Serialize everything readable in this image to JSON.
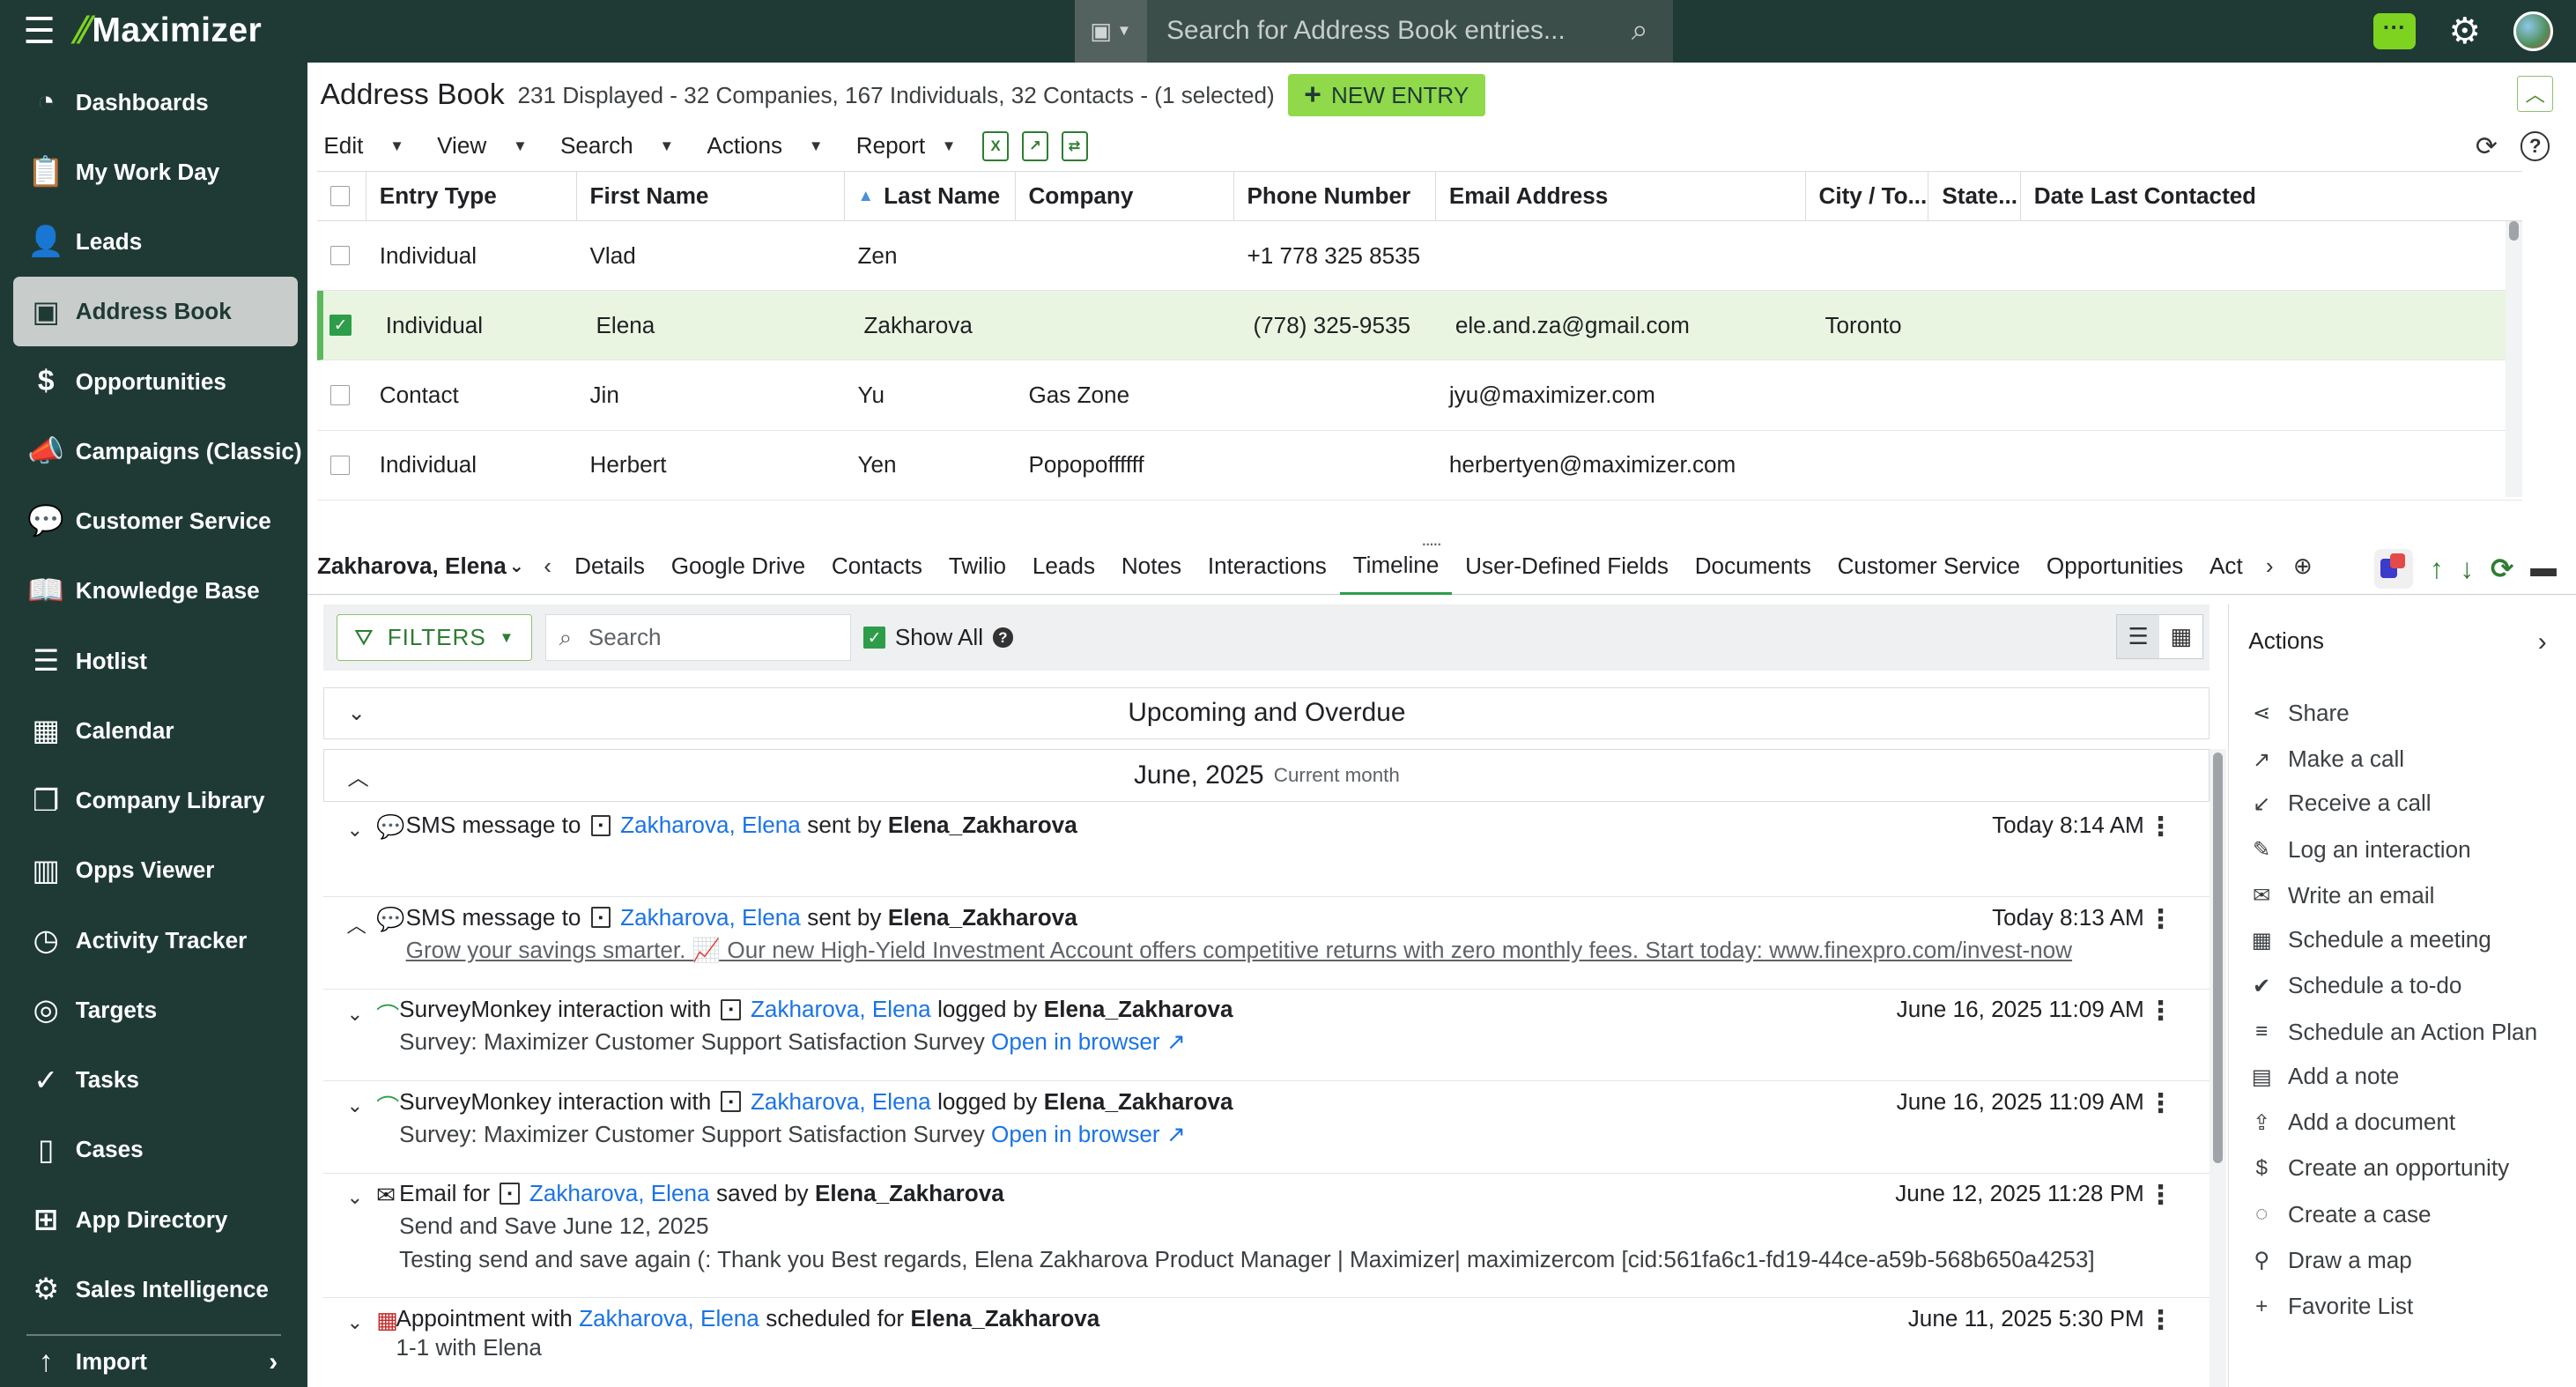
{
  "app": {
    "logo_text": "Maximizer",
    "search_placeholder": "Search for Address Book entries..."
  },
  "sidebar": {
    "items": [
      {
        "label": "Dashboards",
        "icon": "dashboard-icon"
      },
      {
        "label": "My Work Day",
        "icon": "clipboard-icon"
      },
      {
        "label": "Leads",
        "icon": "leads-icon"
      },
      {
        "label": "Address Book",
        "icon": "address-book-icon",
        "active": true
      },
      {
        "label": "Opportunities",
        "icon": "dollar-icon"
      },
      {
        "label": "Campaigns (Classic)",
        "icon": "megaphone-icon"
      },
      {
        "label": "Customer Service",
        "icon": "chat-bubble-icon"
      },
      {
        "label": "Knowledge Base",
        "icon": "book-icon"
      },
      {
        "label": "Hotlist",
        "icon": "list-icon"
      },
      {
        "label": "Calendar",
        "icon": "calendar-icon"
      },
      {
        "label": "Company Library",
        "icon": "documents-icon"
      },
      {
        "label": "Opps Viewer",
        "icon": "columns-icon"
      },
      {
        "label": "Activity Tracker",
        "icon": "calendar-clock-icon"
      },
      {
        "label": "Targets",
        "icon": "target-icon"
      },
      {
        "label": "Tasks",
        "icon": "check-circle-icon"
      },
      {
        "label": "Cases",
        "icon": "cases-icon"
      },
      {
        "label": "App Directory",
        "icon": "app-directory-icon"
      },
      {
        "label": "Sales Intelligence",
        "icon": "sales-intel-icon"
      }
    ],
    "import_label": "Import"
  },
  "address_book": {
    "title": "Address Book",
    "count_text": "231 Displayed - 32 Companies, 167 Individuals, 32 Contacts - (1 selected)",
    "new_entry_label": "NEW ENTRY",
    "menu": [
      "Edit",
      "View",
      "Search",
      "Actions",
      "Report"
    ],
    "columns": [
      "Entry Type",
      "First Name",
      "Last Name",
      "Company",
      "Phone Number",
      "Email Address",
      "City / To...",
      "State...",
      "Date Last Contacted"
    ],
    "rows": [
      {
        "type": "Individual",
        "first": "Vlad",
        "last": "Zen",
        "company": "",
        "phone": "+1 778 325 8535",
        "email": "",
        "city": "",
        "selected": false
      },
      {
        "type": "Individual",
        "first": "Elena",
        "last": "Zakharova",
        "company": "",
        "phone": "(778) 325-9535",
        "email": "ele.and.za@gmail.com",
        "city": "Toronto",
        "selected": true
      },
      {
        "type": "Contact",
        "first": "Jin",
        "last": "Yu",
        "company": "Gas Zone",
        "phone": "",
        "email": "jyu@maximizer.com",
        "city": "",
        "selected": false
      },
      {
        "type": "Individual",
        "first": "Herbert",
        "last": "Yen",
        "company": "Popopoffffff",
        "phone": "",
        "email": "herbertyen@maximizer.com",
        "city": "",
        "selected": false
      }
    ]
  },
  "detail": {
    "entity": "Zakharova, Elena",
    "tabs": [
      "Details",
      "Google Drive",
      "Contacts",
      "Twilio",
      "Leads",
      "Notes",
      "Interactions",
      "Timeline",
      "User-Defined Fields",
      "Documents",
      "Customer Service",
      "Opportunities",
      "Act"
    ],
    "active_tab": "Timeline"
  },
  "timeline": {
    "filters_label": "FILTERS",
    "search_placeholder": "Search",
    "show_all_label": "Show All",
    "section_upcoming": "Upcoming and Overdue",
    "section_month": "June, 2025",
    "section_month_sub": "Current month",
    "items": [
      {
        "pre": "SMS message to",
        "name": "Zakharova, Elena",
        "mid": "sent by",
        "by": "Elena_Zakharova",
        "time": "Today 8:14 AM"
      },
      {
        "pre": "SMS message to",
        "name": "Zakharova, Elena",
        "mid": "sent by",
        "by": "Elena_Zakharova",
        "time": "Today 8:13 AM",
        "line2": "Grow your savings smarter. 📈 Our new High-Yield Investment Account offers competitive returns with zero monthly fees. Start today: www.finexpro.com/invest-now"
      },
      {
        "pre": "SurveyMonkey interaction with",
        "name": "Zakharova, Elena",
        "mid": "logged by",
        "by": "Elena_Zakharova",
        "time": "June 16, 2025 11:09 AM",
        "line2": "Survey: Maximizer Customer Support Satisfaction Survey",
        "link2": "Open in browser"
      },
      {
        "pre": "SurveyMonkey interaction with",
        "name": "Zakharova, Elena",
        "mid": "logged by",
        "by": "Elena_Zakharova",
        "time": "June 16, 2025 11:09 AM",
        "line2": "Survey: Maximizer Customer Support Satisfaction Survey",
        "link2": "Open in browser"
      },
      {
        "pre": "Email for",
        "name": "Zakharova, Elena",
        "mid": "saved by",
        "by": "Elena_Zakharova",
        "time": "June 12, 2025 11:28 PM",
        "line2": "Send and Save June 12, 2025",
        "line3": "Testing send and save again (: Thank you Best regards, Elena Zakharova Product Manager | Maximizer| maximizercom [cid:561fa6c1-fd19-44ce-a59b-568b650a4253]"
      },
      {
        "pre": "Appointment with",
        "name": "Zakharova, Elena",
        "mid": "scheduled for",
        "by": "Elena_Zakharova",
        "time": "June 11, 2025 5:30 PM",
        "line2": "1-1 with Elena"
      }
    ]
  },
  "actions": {
    "title": "Actions",
    "items": [
      "Share",
      "Make a call",
      "Receive a call",
      "Log an interaction",
      "Write an email",
      "Schedule a meeting",
      "Schedule a to-do",
      "Schedule an Action Plan",
      "Add a note",
      "Add a document",
      "Create an opportunity",
      "Create a case",
      "Draw a map",
      "Favorite List"
    ]
  }
}
